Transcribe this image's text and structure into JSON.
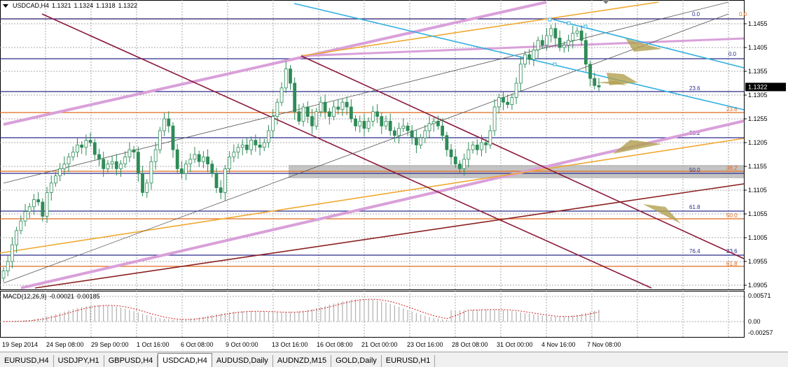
{
  "header": {
    "symbol": "USDCAD,H4",
    "open": "1.1321",
    "high": "1.1324",
    "low": "1.1318",
    "close": "1.1322"
  },
  "price_axis": {
    "labels": [
      "1.1455",
      "1.1405",
      "1.1355",
      "1.1305",
      "1.1255",
      "1.1205",
      "1.1155",
      "1.1105",
      "1.1055",
      "1.1005",
      "1.0955",
      "1.0905"
    ],
    "current_price": "1.1322"
  },
  "fib_labels": {
    "blue": [
      "0.0",
      "0.0",
      "23.6",
      "38.2",
      "50.0",
      "61.8",
      "76.4"
    ],
    "orange": [
      "0.0",
      "23.6",
      "38.2",
      "50.0",
      "61.8"
    ],
    "other": [
      "23.6"
    ]
  },
  "macd": {
    "label": "MACD(12,26,9)",
    "value1": "-0.00021",
    "value2": "0.00185",
    "axis_labels": [
      "0.00571",
      "0.00",
      "-0.00257"
    ]
  },
  "time_axis": [
    "19 Sep 2014",
    "24 Sep 08:00",
    "29 Sep 00:00",
    "1 Oct 16:00",
    "6 Oct 08:00",
    "9 Oct 00:00",
    "13 Oct 16:00",
    "16 Oct 08:00",
    "21 Oct 00:00",
    "23 Oct 16:00",
    "28 Oct 08:00",
    "31 Oct 00:00",
    "4 Nov 16:00",
    "7 Nov 08:00"
  ],
  "tabs": [
    "EURUSD,H4",
    "USDJPY,H1",
    "GBPUSD,H4",
    "USDCAD,H4",
    "AUDUSD,Daily",
    "AUDNZD,M15",
    "GOLD,Daily",
    "EURUSD,H1"
  ],
  "active_tab": "USDCAD,H4",
  "colors": {
    "bull": "#2e8b57",
    "bear": "#2e8b57",
    "grid": "#a8a8a8",
    "fib_blue": "#2b2b8c",
    "fib_orange": "#e06a1c",
    "pink": "#d9a0d9",
    "orange_line": "#f0a830",
    "maroon": "#8b1a3a",
    "brown": "#8b2020",
    "cyan": "#30b0e0",
    "olive": "#b0a050"
  }
}
